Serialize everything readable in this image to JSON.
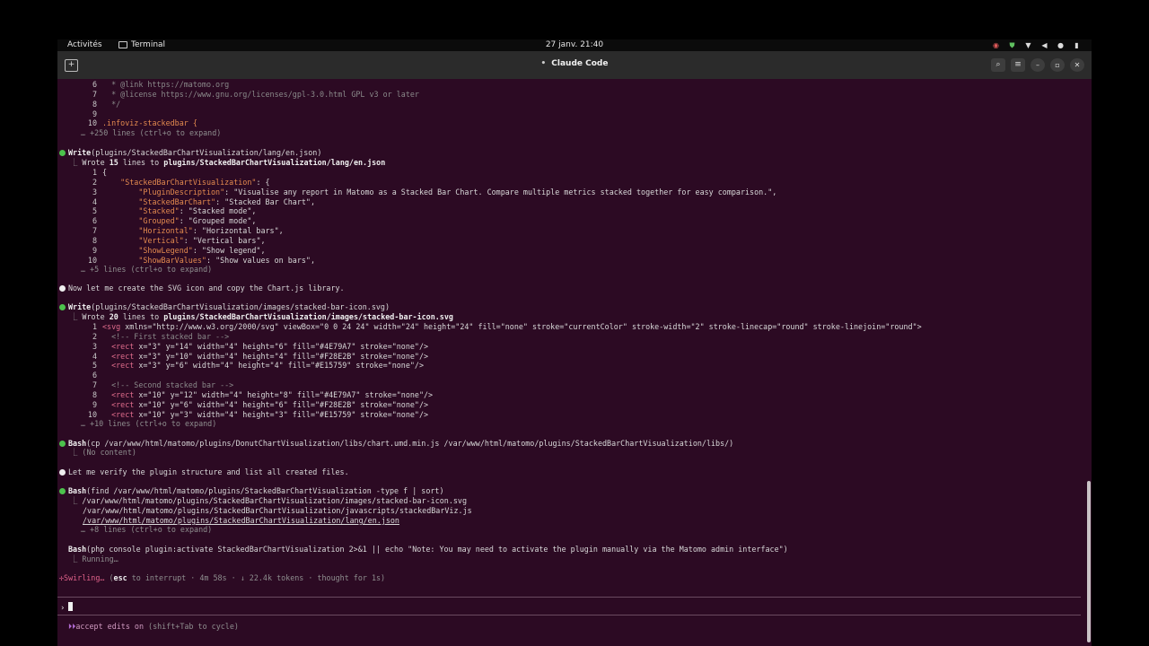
{
  "topbar": {
    "activities": "Activités",
    "terminal": "Terminal",
    "clock": "27 janv. 21:40"
  },
  "window": {
    "title": "Claude Code"
  },
  "code1": [
    {
      "n": "6",
      "t": "  * @link https://matomo.org"
    },
    {
      "n": "7",
      "t": "  * @license https://www.gnu.org/licenses/gpl-3.0.html GPL v3 or later"
    },
    {
      "n": "8",
      "t": "  */"
    },
    {
      "n": "9",
      "t": ""
    },
    {
      "n": "10",
      "t": ".infoviz-stackedbar {"
    }
  ],
  "expand1": "… +250 lines (ctrl+o to expand)",
  "write1": {
    "tool": "Write",
    "args": "(plugins/StackedBarChartVisualization/lang/en.json)",
    "wrote_prefix": "Wrote ",
    "wrote_count": "15",
    "wrote_mid": " lines to ",
    "wrote_path": "plugins/StackedBarChartVisualization/lang/en.json"
  },
  "json_lines": [
    {
      "n": "1",
      "k": "",
      "v": "{"
    },
    {
      "n": "2",
      "k": "    \"StackedBarChartVisualization\"",
      "v": ": {"
    },
    {
      "n": "3",
      "k": "        \"PluginDescription\"",
      "v": ": \"Visualise any report in Matomo as a Stacked Bar Chart. Compare multiple metrics stacked together for easy comparison.\","
    },
    {
      "n": "4",
      "k": "        \"StackedBarChart\"",
      "v": ": \"Stacked Bar Chart\","
    },
    {
      "n": "5",
      "k": "        \"Stacked\"",
      "v": ": \"Stacked mode\","
    },
    {
      "n": "6",
      "k": "        \"Grouped\"",
      "v": ": \"Grouped mode\","
    },
    {
      "n": "7",
      "k": "        \"Horizontal\"",
      "v": ": \"Horizontal bars\","
    },
    {
      "n": "8",
      "k": "        \"Vertical\"",
      "v": ": \"Vertical bars\","
    },
    {
      "n": "9",
      "k": "        \"ShowLegend\"",
      "v": ": \"Show legend\","
    },
    {
      "n": "10",
      "k": "        \"ShowBarValues\"",
      "v": ": \"Show values on bars\","
    }
  ],
  "expand2": "… +5 lines (ctrl+o to expand)",
  "msg1": "Now let me create the SVG icon and copy the Chart.js library.",
  "write2": {
    "tool": "Write",
    "args": "(plugins/StackedBarChartVisualization/images/stacked-bar-icon.svg)",
    "wrote_prefix": "Wrote ",
    "wrote_count": "20",
    "wrote_mid": " lines to ",
    "wrote_path": "plugins/StackedBarChartVisualization/images/stacked-bar-icon.svg"
  },
  "svg_lines": [
    {
      "n": "1",
      "tag": "<svg",
      "rest": " xmlns=\"http://www.w3.org/2000/svg\" viewBox=\"0 0 24 24\" width=\"24\" height=\"24\" fill=\"none\" stroke=\"currentColor\" stroke-width=\"2\" stroke-linecap=\"round\" stroke-linejoin=\"round\">",
      "c": false
    },
    {
      "n": "2",
      "tag": "",
      "rest": "  <!-- First stacked bar -->",
      "c": true
    },
    {
      "n": "3",
      "tag": "  <rect",
      "rest": " x=\"3\" y=\"14\" width=\"4\" height=\"6\" fill=\"#4E79A7\" stroke=\"none\"/>",
      "c": false
    },
    {
      "n": "4",
      "tag": "  <rect",
      "rest": " x=\"3\" y=\"10\" width=\"4\" height=\"4\" fill=\"#F28E2B\" stroke=\"none\"/>",
      "c": false
    },
    {
      "n": "5",
      "tag": "  <rect",
      "rest": " x=\"3\" y=\"6\" width=\"4\" height=\"4\" fill=\"#E15759\" stroke=\"none\"/>",
      "c": false
    },
    {
      "n": "6",
      "tag": "",
      "rest": "",
      "c": false
    },
    {
      "n": "7",
      "tag": "",
      "rest": "  <!-- Second stacked bar -->",
      "c": true
    },
    {
      "n": "8",
      "tag": "  <rect",
      "rest": " x=\"10\" y=\"12\" width=\"4\" height=\"8\" fill=\"#4E79A7\" stroke=\"none\"/>",
      "c": false
    },
    {
      "n": "9",
      "tag": "  <rect",
      "rest": " x=\"10\" y=\"6\" width=\"4\" height=\"6\" fill=\"#F28E2B\" stroke=\"none\"/>",
      "c": false
    },
    {
      "n": "10",
      "tag": "  <rect",
      "rest": " x=\"10\" y=\"3\" width=\"4\" height=\"3\" fill=\"#E15759\" stroke=\"none\"/>",
      "c": false
    }
  ],
  "expand3": "… +10 lines (ctrl+o to expand)",
  "bash1": {
    "tool": "Bash",
    "args": "(cp /var/www/html/matomo/plugins/DonutChartVisualization/libs/chart.umd.min.js /var/www/html/matomo/plugins/StackedBarChartVisualization/libs/)",
    "out": "(No content)"
  },
  "msg2": "Let me verify the plugin structure and list all created files.",
  "bash2": {
    "tool": "Bash",
    "args": "(find /var/www/html/matomo/plugins/StackedBarChartVisualization -type f | sort)",
    "out1": "/var/www/html/matomo/plugins/StackedBarChartVisualization/images/stacked-bar-icon.svg",
    "out2": "/var/www/html/matomo/plugins/StackedBarChartVisualization/javascripts/stackedBarViz.js",
    "out3": "/var/www/html/matomo/plugins/StackedBarChartVisualization/lang/en.json",
    "expand": "… +8 lines (ctrl+o to expand)"
  },
  "bash3": {
    "tool": "Bash",
    "args": "(php console plugin:activate StackedBarChartVisualization 2>&1 || echo \"Note: You may need to activate the plugin manually via the Matomo admin interface\")",
    "out": "Running…"
  },
  "status": {
    "spinner": "✢",
    "word": "Swirling…",
    "detail_pre": " (",
    "esc": "esc",
    "detail": " to interrupt · 4m 58s · ↓ 22.4k tokens · thought for 1s)"
  },
  "prompt": {
    "symbol": "›"
  },
  "footer": {
    "icon": "⏵⏵",
    "text": "accept edits on",
    "hint": " (shift+Tab to cycle)"
  }
}
